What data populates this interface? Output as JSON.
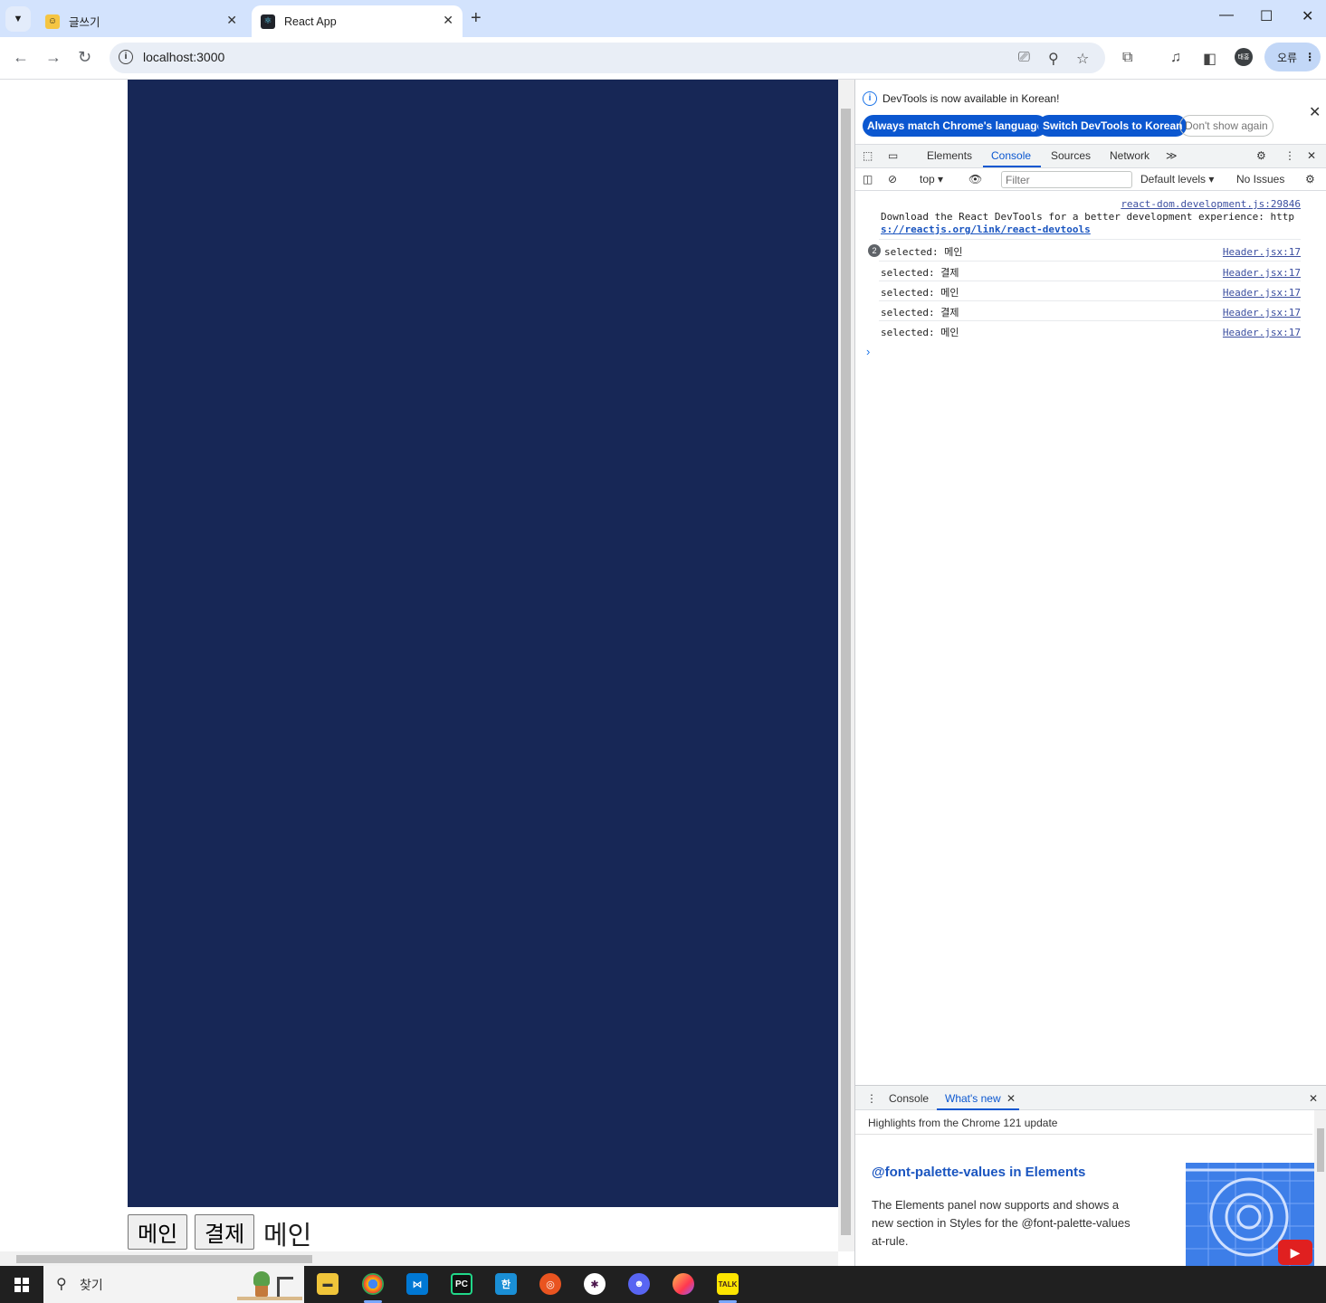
{
  "browser": {
    "tabs": [
      {
        "title": "글쓰기",
        "favicon": "smiley-note-icon"
      },
      {
        "title": "React App",
        "favicon": "react-icon"
      }
    ],
    "url": "localhost:3000",
    "profile_initials": "태홍",
    "error_pill": "오류"
  },
  "page": {
    "buttons": [
      "메인",
      "결제"
    ],
    "selected_text": "메인",
    "panel_color": "#172756"
  },
  "devtools": {
    "info_message": "DevTools is now available in Korean!",
    "info_buttons": {
      "match": "Always match Chrome's language",
      "switch": "Switch DevTools to Korean",
      "dont_show": "Don't show again"
    },
    "tabs": [
      "Elements",
      "Console",
      "Sources",
      "Network"
    ],
    "active_tab": "Console",
    "console_toolbar": {
      "context": "top",
      "filter_placeholder": "Filter",
      "levels": "Default levels",
      "issues": "No Issues"
    },
    "logs": [
      {
        "source": "react-dom.development.js:29846",
        "message": "Download the React DevTools for a better development experience: http",
        "message2": "s://reactjs.org/link/react-devtools"
      },
      {
        "count": "2",
        "message": "selected: 메인",
        "source": "Header.jsx:17"
      },
      {
        "message": "selected: 결제",
        "source": "Header.jsx:17"
      },
      {
        "message": "selected: 메인",
        "source": "Header.jsx:17"
      },
      {
        "message": "selected: 결제",
        "source": "Header.jsx:17"
      },
      {
        "message": "selected: 메인",
        "source": "Header.jsx:17"
      }
    ],
    "drawer": {
      "tabs": [
        "Console",
        "What's new"
      ],
      "highlights": "Highlights from the Chrome 121 update",
      "feature_title": "@font-palette-values in Elements",
      "feature_desc": "The Elements panel now supports and shows a new section in Styles for the @font-palette-values at-rule."
    }
  },
  "taskbar": {
    "search_label": "찾기",
    "apps": [
      "file-explorer-icon",
      "chrome-icon",
      "vscode-icon",
      "pycharm-icon",
      "hangul-icon",
      "ubuntu-icon",
      "slack-icon",
      "discord-icon",
      "firefox-icon",
      "kakaotalk-icon"
    ],
    "pycharm_label": "PC",
    "hangul_label": "한",
    "kakao_label": "TALK"
  }
}
